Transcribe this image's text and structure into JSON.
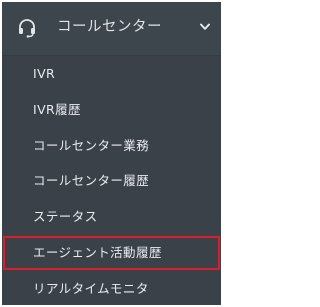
{
  "header": {
    "title": "コールセンター",
    "icon": "headset-icon",
    "toggle_icon": "chevron-down-icon"
  },
  "menu": {
    "items": [
      {
        "label": "IVR"
      },
      {
        "label": "IVR履歴"
      },
      {
        "label": "コールセンター業務"
      },
      {
        "label": "コールセンター履歴"
      },
      {
        "label": "ステータス"
      },
      {
        "label": "エージェント活動履歴",
        "highlighted": true
      },
      {
        "label": "リアルタイムモニタ"
      }
    ]
  },
  "colors": {
    "background": "#3a4148",
    "text": "#e9ecef",
    "highlight_border": "#d9202a"
  }
}
